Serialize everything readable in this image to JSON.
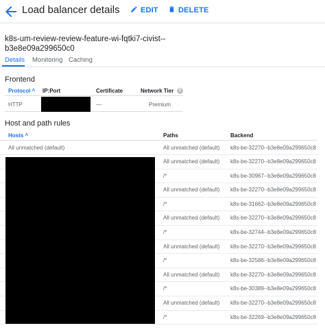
{
  "header": {
    "title": "Load balancer details",
    "edit_label": "EDIT",
    "delete_label": "DELETE"
  },
  "lb_name": {
    "line1": "k8s-um-review-review-feature-wi-fqtki7-civist--",
    "line2": "b3e8e09a299650c0"
  },
  "tabs": [
    {
      "label": "Details",
      "active": true
    },
    {
      "label": "Monitoring",
      "active": false
    },
    {
      "label": "Caching",
      "active": false
    }
  ],
  "frontend": {
    "title": "Frontend",
    "columns": [
      "Protocol",
      "IP:Port",
      "Certificate",
      "Network Tier"
    ],
    "sort_indicator": "^",
    "row": {
      "protocol": "HTTP",
      "ip_port": "",
      "certificate": "—",
      "network_tier": "Premium"
    },
    "help_glyph": "?"
  },
  "host_path": {
    "title": "Host and path rules",
    "columns": [
      "Hosts",
      "Paths",
      "Backend"
    ],
    "sort_indicator": "^",
    "rows": [
      {
        "host": "All unmatched (default)",
        "path": "All unmatched (default)",
        "backend": "k8s-be-32270--b3e8e09a299650c8"
      },
      {
        "host": "",
        "path": "All unmatched (default)",
        "backend": "k8s-be-32270--b3e8e09a299650c8"
      },
      {
        "host": "",
        "path": "/*",
        "backend": "k8s-be-30967--b3e8e09a299650c8"
      },
      {
        "host": "",
        "path": "All unmatched (default)",
        "backend": "k8s-be-32270--b3e8e09a299650c8"
      },
      {
        "host": "",
        "path": "/*",
        "backend": "k8s-be-31662--b3e8e09a299650c8"
      },
      {
        "host": "",
        "path": "All unmatched (default)",
        "backend": "k8s-be-32270--b3e8e09a299650c8"
      },
      {
        "host": "",
        "path": "/*",
        "backend": "k8s-be-32744--b3e8e09a299650c8"
      },
      {
        "host": "",
        "path": "All unmatched (default)",
        "backend": "k8s-be-32270--b3e8e09a299650c8"
      },
      {
        "host": "",
        "path": "/*",
        "backend": "k8s-be-32586--b3e8e09a299650c8"
      },
      {
        "host": "",
        "path": "All unmatched (default)",
        "backend": "k8s-be-32270--b3e8e09a299650c8"
      },
      {
        "host": "",
        "path": "/*",
        "backend": "k8s-be-30389--b3e8e09a299650c8"
      },
      {
        "host": "",
        "path": "All unmatched (default)",
        "backend": "k8s-be-32270--b3e8e09a299650c8"
      },
      {
        "host": "",
        "path": "/*",
        "backend": "k8s-be-32269--b3e8e09a299650c8"
      }
    ]
  },
  "colors": {
    "accent": "#1a73e8",
    "text": "#202124",
    "muted": "#5f6368",
    "redaction": "#000000"
  },
  "icons": {
    "back": "arrow-back-icon",
    "edit": "pencil-icon",
    "delete": "trash-icon",
    "sort": "arrow-up-icon",
    "help": "help-circle-icon"
  }
}
